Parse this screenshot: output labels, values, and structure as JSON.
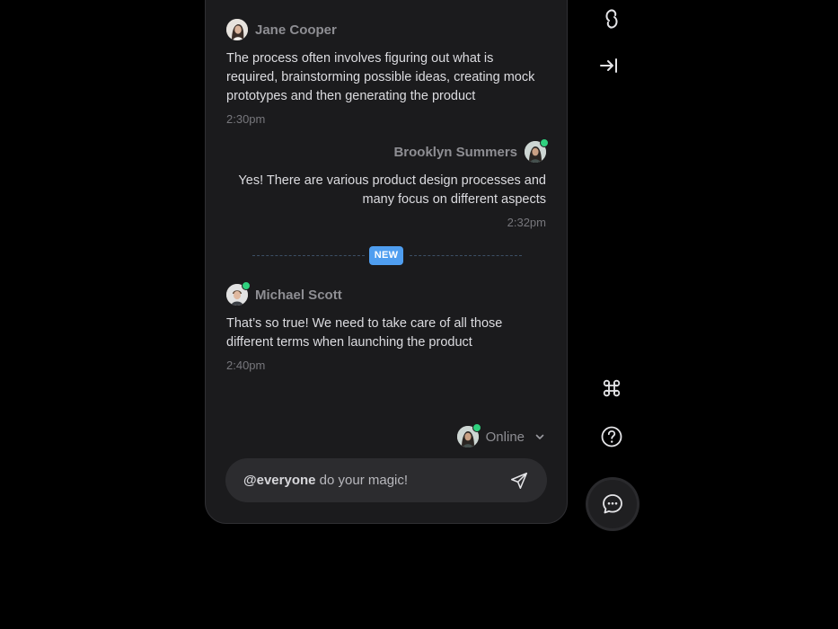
{
  "messages": [
    {
      "author": "Jane Cooper",
      "text": "The process often involves figuring out what is required, brainstorming possible ideas, creating mock prototypes and then generating the product",
      "time": "2:30pm",
      "side": "left",
      "online": false
    },
    {
      "author": "Brooklyn Summers",
      "text": "Yes! There are various product design processes and many focus on different aspects",
      "time": "2:32pm",
      "side": "right",
      "online": true
    },
    {
      "author": "Michael Scott",
      "text": "That’s so true! We need to take care of all those different terms when launching the product",
      "time": "2:40pm",
      "side": "left",
      "online": true
    }
  ],
  "divider": {
    "label": "NEW"
  },
  "status": {
    "label": "Online"
  },
  "composer": {
    "mention": "@everyone",
    "text": " do your magic!"
  },
  "icons": {
    "top": [
      "link-icon",
      "collapse-to-right-icon"
    ],
    "bottom": [
      "command-icon",
      "help-icon",
      "chat-bubble-icon"
    ],
    "send": "send-icon",
    "chevron": "chevron-down-icon"
  },
  "colors": {
    "background": "#000000",
    "panel": "#1b1b1d",
    "composer": "#2c2c2f",
    "accent": "#4f9ef0",
    "online": "#2fd17e"
  }
}
